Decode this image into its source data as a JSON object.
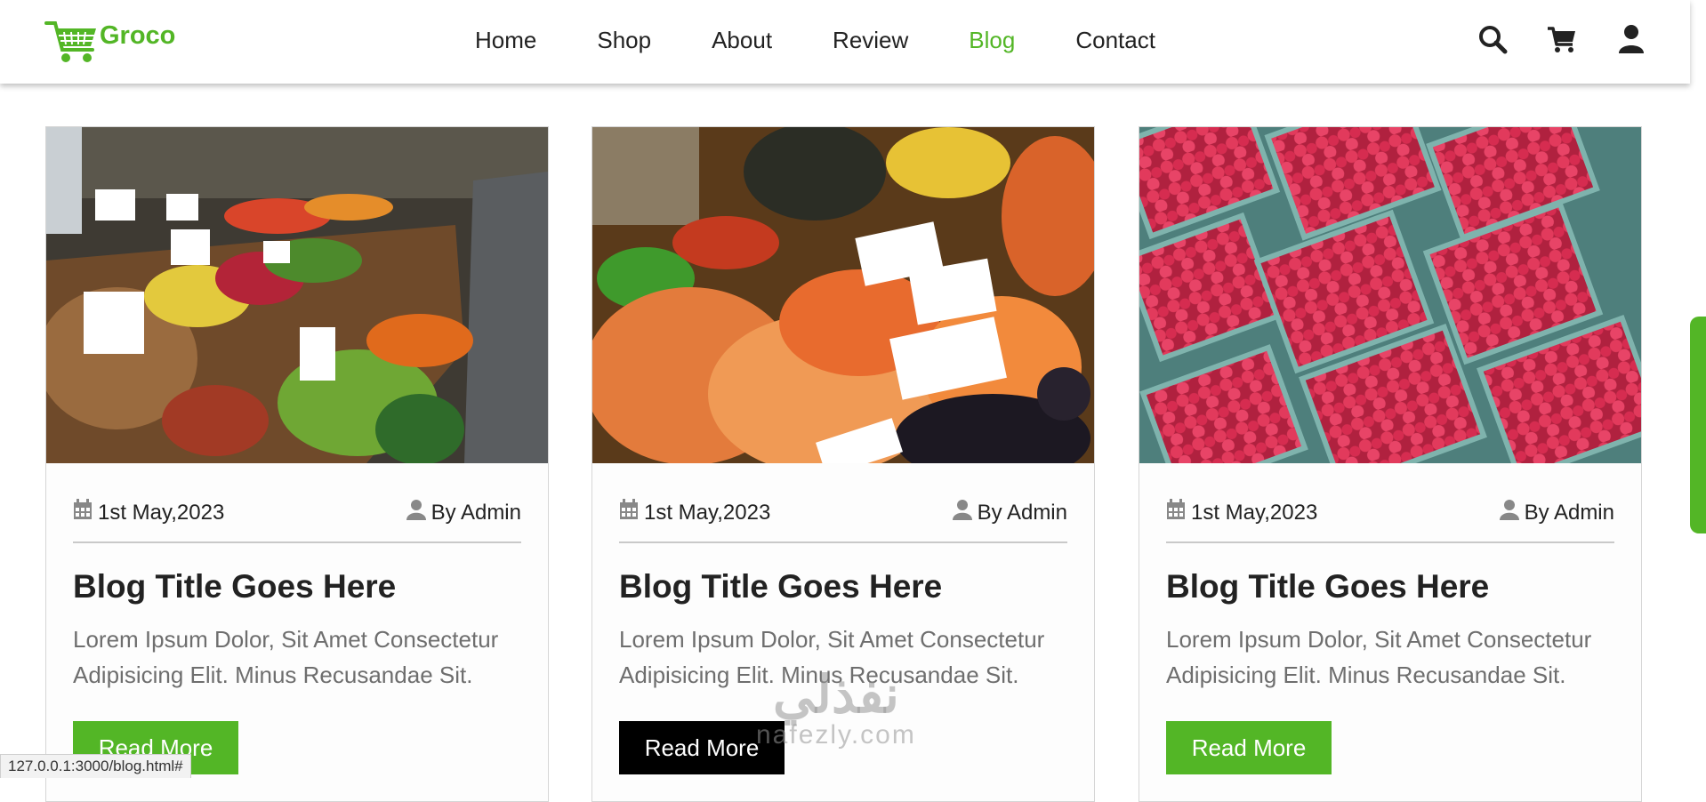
{
  "brand": {
    "name": "Groco",
    "accent": "#53b626"
  },
  "nav": {
    "items": [
      {
        "label": "Home",
        "active": false
      },
      {
        "label": "Shop",
        "active": false
      },
      {
        "label": "About",
        "active": false
      },
      {
        "label": "Review",
        "active": false
      },
      {
        "label": "Blog",
        "active": true
      },
      {
        "label": "Contact",
        "active": false
      }
    ]
  },
  "header_icons": [
    "search-icon",
    "cart-icon",
    "user-icon"
  ],
  "posts": [
    {
      "image": "vegetable-market-stall",
      "date": "1st May,2023",
      "author": "By Admin",
      "title": "Blog Title Goes Here",
      "text": "Lorem Ipsum Dolor, Sit Amet Consectetur Adipisicing Elit. Minus Recusandae Sit.",
      "button": "Read More",
      "button_state": "default"
    },
    {
      "image": "fruit-market-stall",
      "date": "1st May,2023",
      "author": "By Admin",
      "title": "Blog Title Goes Here",
      "text": "Lorem Ipsum Dolor, Sit Amet Consectetur Adipisicing Elit. Minus Recusandae Sit.",
      "button": "Read More",
      "button_state": "hover"
    },
    {
      "image": "raspberry-baskets",
      "date": "1st May,2023",
      "author": "By Admin",
      "title": "Blog Title Goes Here",
      "text": "Lorem Ipsum Dolor, Sit Amet Consectetur Adipisicing Elit. Minus Recusandae Sit.",
      "button": "Read More",
      "button_state": "default"
    }
  ],
  "status_bar": {
    "url": "127.0.0.1:3000/blog.html#"
  },
  "watermark": {
    "arabic": "نفذلي",
    "latin": "nafezly.com"
  }
}
